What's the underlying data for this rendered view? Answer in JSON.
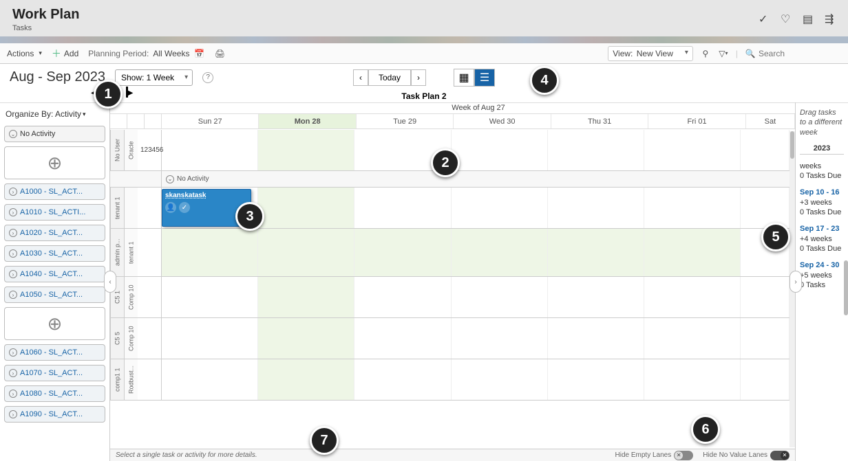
{
  "header": {
    "title": "Work Plan",
    "subtitle": "Tasks"
  },
  "toolbar": {
    "actions": "Actions",
    "add": "Add",
    "planning_label": "Planning Period:",
    "planning_value": "All Weeks",
    "view_label": "View:",
    "view_value": "New View",
    "search_placeholder": "Search"
  },
  "controls": {
    "period_title": "Aug - Sep 2023",
    "show_label": "Show: 1 Week",
    "today": "Today",
    "plan_title": "Task Plan 2",
    "week_of": "Week of Aug 27"
  },
  "days": [
    {
      "short": "Sun 27",
      "today": false
    },
    {
      "short": "Mon 28",
      "today": true
    },
    {
      "short": "Tue 29",
      "today": false
    },
    {
      "short": "Wed 30",
      "today": false
    },
    {
      "short": "Thu 31",
      "today": false
    },
    {
      "short": "Fri 01",
      "today": false
    },
    {
      "short": "Sat",
      "today": false
    }
  ],
  "sidebar": {
    "organize_label": "Organize By: Activity",
    "no_activity": "No Activity",
    "activities_top": [
      "A1000 - SL_ACT...",
      "A1010 - SL_ACTI...",
      "A1020 - SL_ACT...",
      "A1030 - SL_ACT...",
      "A1040 - SL_ACT...",
      "A1050 - SL_ACT..."
    ],
    "activities_bottom": [
      "A1060 - SL_ACT...",
      "A1070 - SL_ACT...",
      "A1080 - SL_ACT...",
      "A1090 - SL_ACT..."
    ]
  },
  "lanes": {
    "row1_outer": "No User",
    "row1_inner": "Oracle",
    "row1_task": "123456",
    "grp_no_activity": "No Activity",
    "row2_outer": "tenant 1",
    "task_card_name": "skanskatask",
    "row3_outer": "admin p...",
    "row3_inner": "tenant 1",
    "row4_outer": "C5 1",
    "row4_inner": "Comp 10",
    "row5_outer": "C5 5",
    "row5_inner": "Comp 10",
    "row6_outer": "comp1 1",
    "row6_inner": "Rodbust..."
  },
  "right": {
    "hint": "Drag tasks to a different week",
    "year": "2023",
    "blocks": [
      {
        "range": "",
        "rel": "weeks",
        "due": "0 Tasks Due"
      },
      {
        "range": "Sep 10 - 16",
        "rel": "+3 weeks",
        "due": "0 Tasks Due"
      },
      {
        "range": "Sep 17 - 23",
        "rel": "+4 weeks",
        "due": "0 Tasks Due"
      },
      {
        "range": "Sep 24 - 30",
        "rel": "+5 weeks",
        "due": "0 Tasks"
      }
    ]
  },
  "footer": {
    "hint": "Select a single task or activity for more details.",
    "hide_empty": "Hide Empty Lanes",
    "hide_novalue": "Hide No Value Lanes"
  },
  "annotations": [
    "1",
    "2",
    "3",
    "4",
    "5",
    "6",
    "7"
  ]
}
